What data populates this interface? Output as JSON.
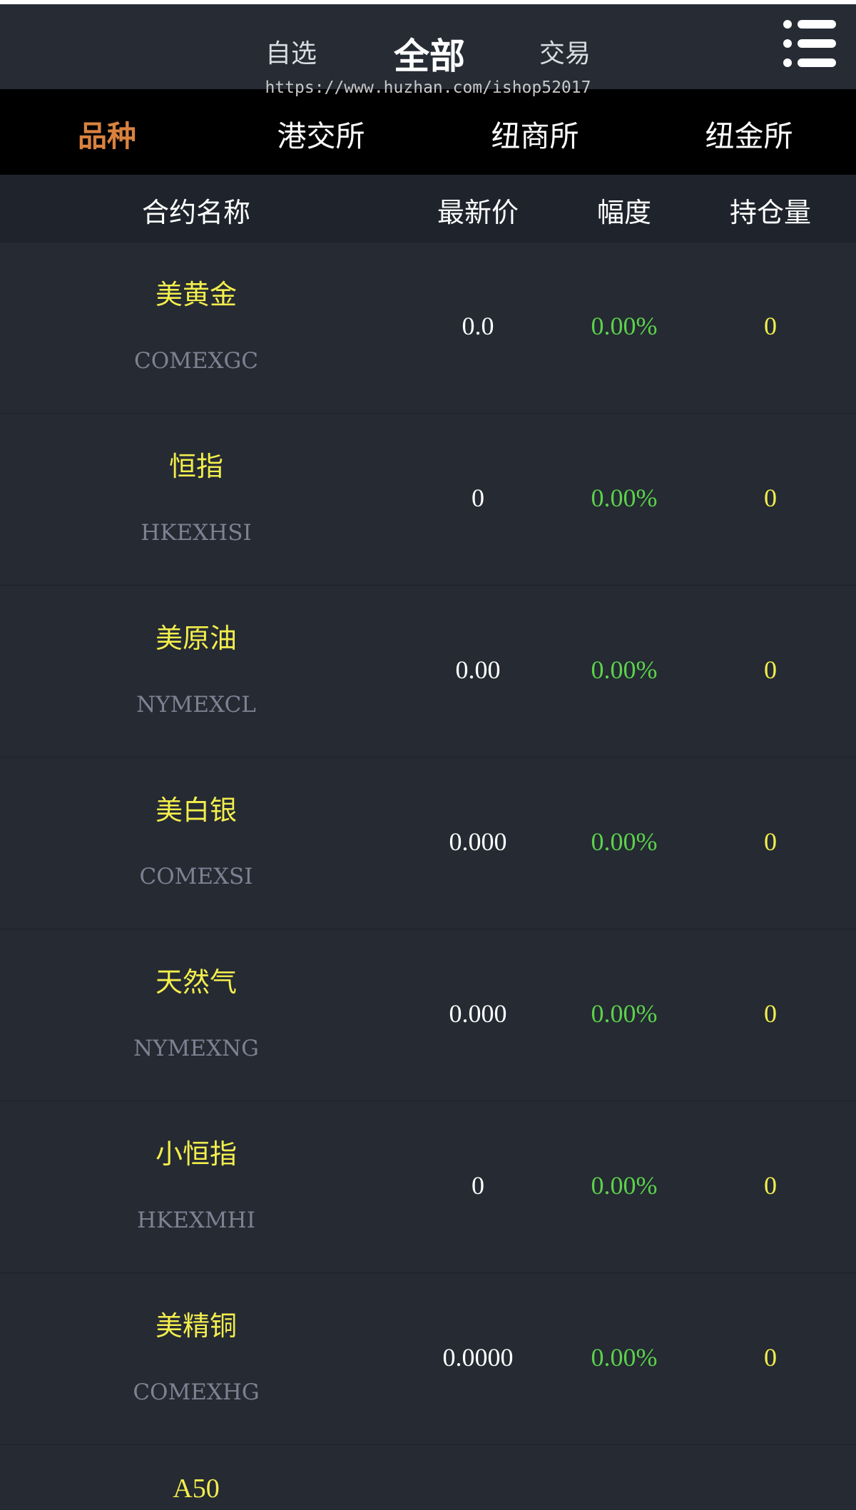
{
  "top_tabs": [
    {
      "label": "自选"
    },
    {
      "label": "全部"
    },
    {
      "label": "交易"
    }
  ],
  "active_top_tab": "全部",
  "watermark": "https://www.huzhan.com/ishop52017",
  "exchanges": [
    {
      "label": "品种"
    },
    {
      "label": "港交所"
    },
    {
      "label": "纽商所"
    },
    {
      "label": "纽金所"
    }
  ],
  "active_exchange": "品种",
  "columns": {
    "name": "合约名称",
    "price": "最新价",
    "change": "幅度",
    "holding": "持仓量"
  },
  "rows": [
    {
      "name": "美黄金",
      "code": "COMEXGC",
      "price": "0.0",
      "change": "0.00%",
      "holding": "0"
    },
    {
      "name": "恒指",
      "code": "HKEXHSI",
      "price": "0",
      "change": "0.00%",
      "holding": "0"
    },
    {
      "name": "美原油",
      "code": "NYMEXCL",
      "price": "0.00",
      "change": "0.00%",
      "holding": "0"
    },
    {
      "name": "美白银",
      "code": "COMEXSI",
      "price": "0.000",
      "change": "0.00%",
      "holding": "0"
    },
    {
      "name": "天然气",
      "code": "NYMEXNG",
      "price": "0.000",
      "change": "0.00%",
      "holding": "0"
    },
    {
      "name": "小恒指",
      "code": "HKEXMHI",
      "price": "0",
      "change": "0.00%",
      "holding": "0"
    },
    {
      "name": "美精铜",
      "code": "COMEXHG",
      "price": "0.0000",
      "change": "0.00%",
      "holding": "0"
    },
    {
      "name": "A50",
      "code": "",
      "price": "",
      "change": "",
      "holding": ""
    }
  ],
  "colors": {
    "background": "#252a33",
    "accent_orange": "#d9823f",
    "name_yellow": "#f3ee4c",
    "change_green": "#5bd24a",
    "code_grey": "#7c8291"
  },
  "icons": {
    "menu": "list-menu-icon"
  }
}
